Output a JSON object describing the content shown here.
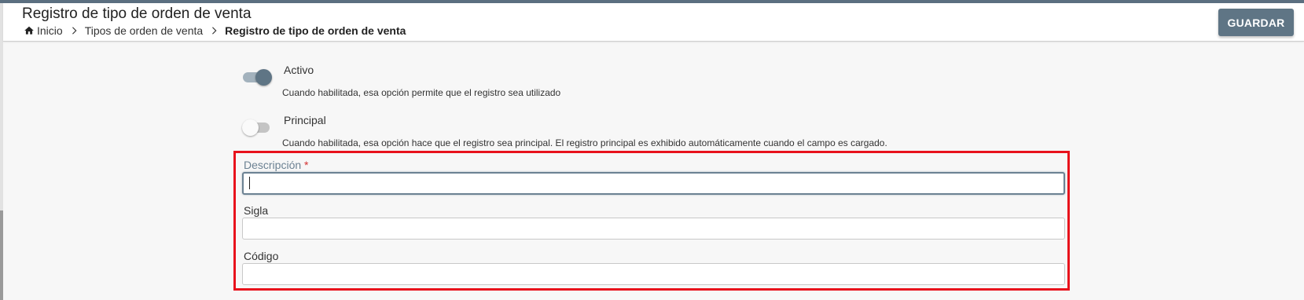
{
  "header": {
    "title": "Registro de tipo de orden de venta",
    "save_label": "GUARDAR"
  },
  "breadcrumb": {
    "items": [
      "Inicio",
      "Tipos de orden de venta"
    ],
    "current": "Registro de tipo de orden de venta",
    "home_icon": "home-icon",
    "separator_icon": "chevron-right-icon"
  },
  "form": {
    "toggles": [
      {
        "label": "Activo",
        "hint": "Cuando habilitada, esa opción permite que el registro sea utilizado",
        "on": true
      },
      {
        "label": "Principal",
        "hint": "Cuando habilitada, esa opción hace que el registro sea principal. El registro principal es exhibido automáticamente cuando el campo es cargado.",
        "on": false
      }
    ],
    "fields": [
      {
        "label": "Descripción",
        "required_mark": "*",
        "value": "",
        "focused": true
      },
      {
        "label": "Sigla",
        "value": ""
      },
      {
        "label": "Código",
        "value": ""
      }
    ]
  },
  "colors": {
    "accent": "#5f7585",
    "highlight_border": "#e8121c",
    "required": "#d32f2f"
  }
}
